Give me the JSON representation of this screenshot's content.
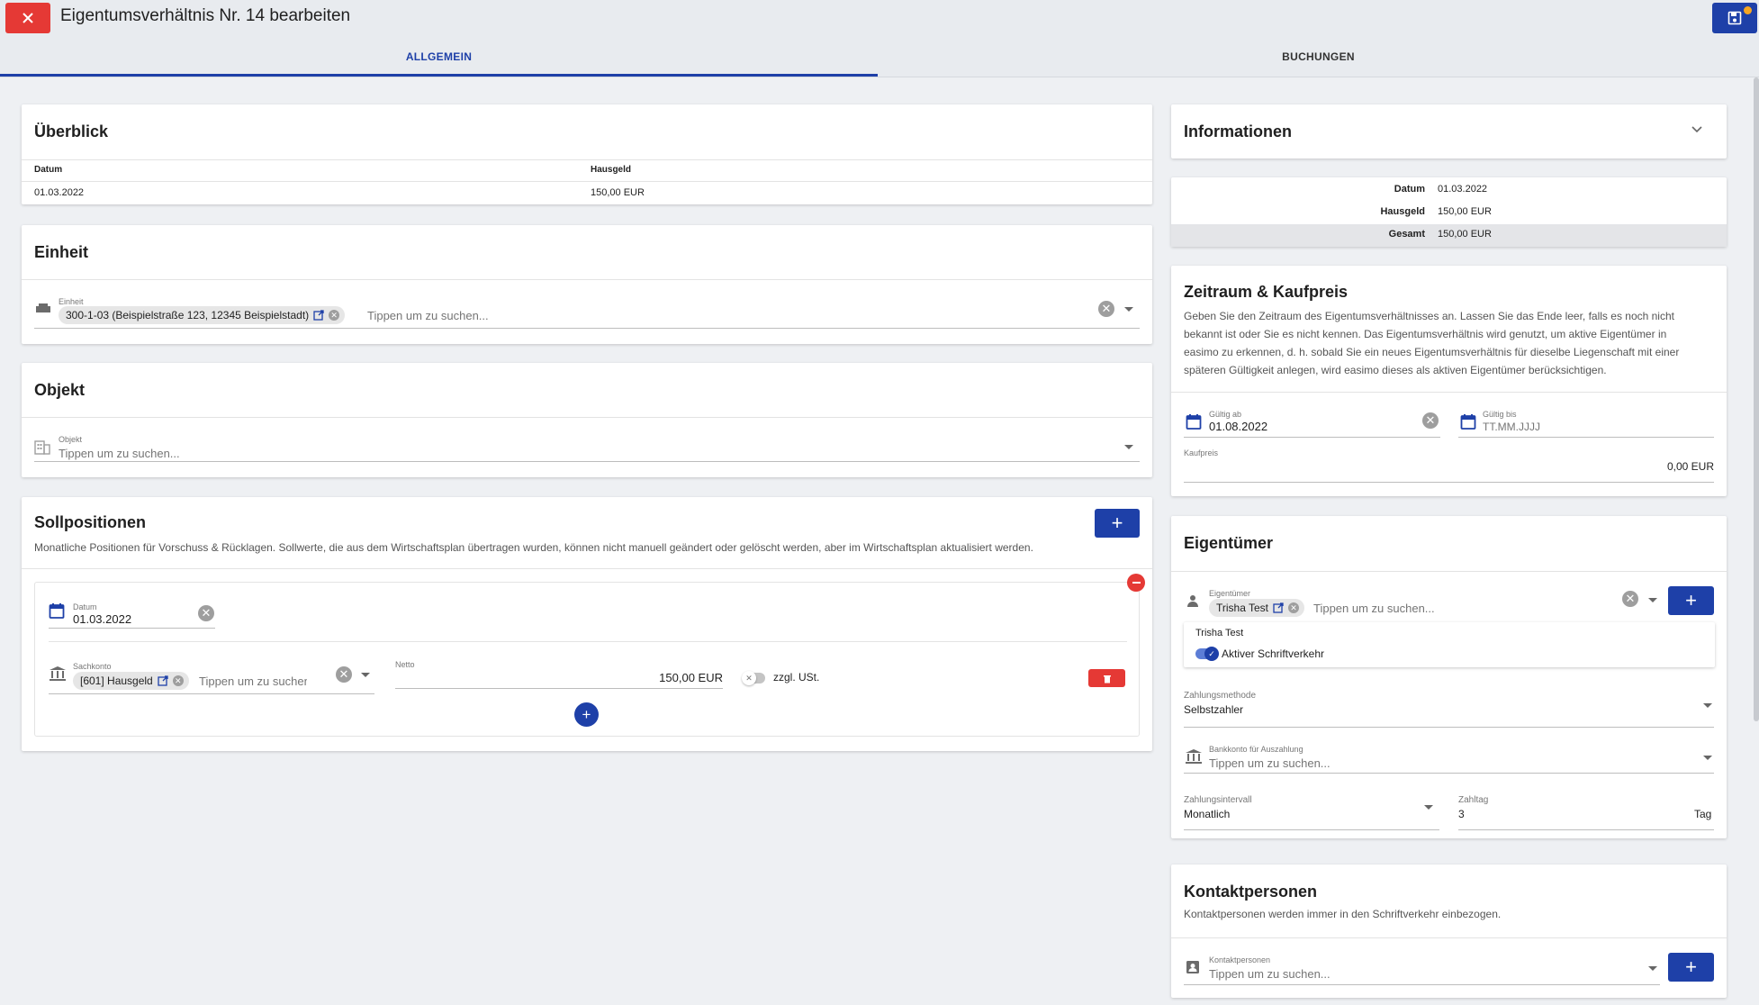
{
  "header": {
    "title": "Eigentumsverhältnis Nr. 14 bearbeiten",
    "tabs": [
      {
        "label": "ALLGEMEIN"
      },
      {
        "label": "BUCHUNGEN"
      }
    ]
  },
  "overview": {
    "title": "Überblick",
    "columns": [
      "Datum",
      "Hausgeld"
    ],
    "row": [
      "01.03.2022",
      "150,00 EUR"
    ]
  },
  "unit": {
    "title": "Einheit",
    "field_label": "Einheit",
    "chip": "300-1-03 (Beispielstraße 123, 12345 Beispielstadt)",
    "placeholder": "Tippen um zu suchen..."
  },
  "object": {
    "title": "Objekt",
    "field_label": "Objekt",
    "placeholder": "Tippen um zu suchen..."
  },
  "target_positions": {
    "title": "Sollpositionen",
    "description": "Monatliche Positionen für Vorschuss & Rücklagen. Sollwerte, die aus dem Wirtschaftsplan übertragen wurden, können nicht manuell geändert oder gelöscht werden, aber im Wirtschaftsplan aktualisiert werden.",
    "date_label": "Datum",
    "date_value": "01.03.2022",
    "account_label": "Sachkonto",
    "account_chip": "[601] Hausgeld",
    "account_placeholder": "Tippen um zu suchen...",
    "net_label": "Netto",
    "net_value": "150,00 EUR",
    "vat_label": "zzgl. USt."
  },
  "information": {
    "title": "Informationen",
    "rows": [
      {
        "label": "Datum",
        "value": "01.03.2022"
      },
      {
        "label": "Hausgeld",
        "value": "150,00 EUR"
      },
      {
        "label": "Gesamt",
        "value": "150,00 EUR"
      }
    ]
  },
  "period": {
    "title": "Zeitraum & Kaufpreis",
    "description_lines": [
      "Geben Sie den Zeitraum des Eigentumsverhältnisses an. Lassen Sie das Ende leer, falls es noch nicht",
      "bekannt ist oder Sie es nicht kennen. Das Eigentumsverhältnis wird genutzt, um aktive Eigentümer in",
      "easimo zu erkennen, d. h. sobald Sie ein neues Eigentumsverhältnis für dieselbe Liegenschaft mit einer",
      "späteren Gültigkeit anlegen, wird easimo dieses als aktiven Eigentümer berücksichtigen."
    ],
    "valid_from_label": "Gültig ab",
    "valid_from_value": "01.08.2022",
    "valid_to_label": "Gültig bis",
    "valid_to_placeholder": "TT.MM.JJJJ",
    "price_label": "Kaufpreis",
    "price_value": "0,00 EUR"
  },
  "owners": {
    "title": "Eigentümer",
    "field_label": "Eigentümer",
    "chip": "Trisha Test",
    "placeholder": "Tippen um zu suchen...",
    "selected_name": "Trisha Test",
    "correspondence_label": "Aktiver Schriftverkehr",
    "payment_method_label": "Zahlungsmethode",
    "payment_method_value": "Selbstzahler",
    "bank_label": "Bankkonto für Auszahlung",
    "bank_placeholder": "Tippen um zu suchen...",
    "interval_label": "Zahlungsintervall",
    "interval_value": "Monatlich",
    "payday_label": "Zahltag",
    "payday_value": "3",
    "payday_suffix": "Tag"
  },
  "contacts": {
    "title": "Kontaktpersonen",
    "description": "Kontaktpersonen werden immer in den Schriftverkehr einbezogen.",
    "field_label": "Kontaktpersonen",
    "placeholder": "Tippen um zu suchen..."
  },
  "colors": {
    "primary": "#1e40a8",
    "danger": "#e53935",
    "badge": "#f5a623"
  }
}
